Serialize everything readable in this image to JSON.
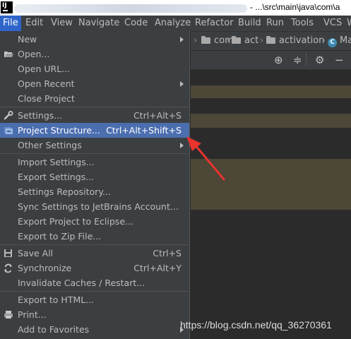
{
  "titlebar": {
    "logo": "IJ",
    "path": "- ...\\src\\main\\java\\com\\a"
  },
  "menubar": [
    {
      "label": "File",
      "active": true
    },
    {
      "label": "Edit"
    },
    {
      "label": "View"
    },
    {
      "label": "Navigate"
    },
    {
      "label": "Code"
    },
    {
      "label": "Analyze"
    },
    {
      "label": "Refactor"
    },
    {
      "label": "Build"
    },
    {
      "label": "Run"
    },
    {
      "label": "Tools"
    },
    {
      "label": "VCS"
    },
    {
      "label": "W"
    }
  ],
  "navbar": {
    "crumbs": [
      "com",
      "act",
      "activation",
      "Ma"
    ],
    "class_icon": "c-class-icon"
  },
  "toolstrip": [
    "target-icon",
    "split-icon",
    "gear-icon",
    "minimize-icon"
  ],
  "file_menu": {
    "items": [
      {
        "label": "New",
        "shortcut": "",
        "submenu": true
      },
      {
        "label": "Open...",
        "shortcut": "",
        "icon": "folder-open-icon"
      },
      {
        "label": "Open URL...",
        "shortcut": ""
      },
      {
        "label": "Open Recent",
        "shortcut": "",
        "submenu": true
      },
      {
        "label": "Close Project",
        "shortcut": ""
      },
      {
        "label": "Settings...",
        "shortcut": "Ctrl+Alt+S",
        "icon": "wrench-icon"
      },
      {
        "label": "Project Structure...",
        "shortcut": "Ctrl+Alt+Shift+S",
        "icon": "project-structure-icon",
        "selected": true
      },
      {
        "label": "Other Settings",
        "shortcut": "",
        "submenu": true
      },
      {
        "label": "Import Settings...",
        "shortcut": ""
      },
      {
        "label": "Export Settings...",
        "shortcut": ""
      },
      {
        "label": "Settings Repository...",
        "shortcut": ""
      },
      {
        "label": "Sync Settings to JetBrains Account...",
        "shortcut": ""
      },
      {
        "label": "Export Project to Eclipse...",
        "shortcut": ""
      },
      {
        "label": "Export to Zip File...",
        "shortcut": ""
      },
      {
        "label": "Save All",
        "shortcut": "Ctrl+S",
        "icon": "save-icon"
      },
      {
        "label": "Synchronize",
        "shortcut": "Ctrl+Alt+Y",
        "icon": "sync-icon"
      },
      {
        "label": "Invalidate Caches / Restart...",
        "shortcut": ""
      },
      {
        "label": "Export to HTML...",
        "shortcut": ""
      },
      {
        "label": "Print...",
        "shortcut": "",
        "icon": "print-icon"
      },
      {
        "label": "Add to Favorites",
        "shortcut": "",
        "submenu": true
      }
    ]
  },
  "annotation": {
    "color": "#e8332e"
  },
  "watermark": "https://blog.csdn.net/qq_36270361",
  "colors": {
    "menu_bg": "#3c3f41",
    "selection": "#4b6eaf",
    "active_menu": "#2f65ca",
    "editor_bg": "#2b2b2b",
    "highlight": "#4d4738"
  }
}
